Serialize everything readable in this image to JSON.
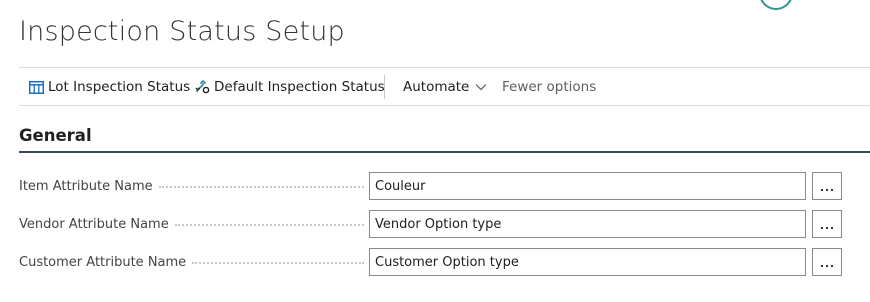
{
  "page": {
    "title": "Inspection Status Setup"
  },
  "actions": {
    "lot_inspection_status": {
      "label": "Lot Inspection Status",
      "icon": "table-icon"
    },
    "default_inspection_status": {
      "label": "Default Inspection Status",
      "icon": "flow-icon"
    },
    "automate": {
      "label": "Automate",
      "icon": "chevron-down-icon"
    },
    "fewer_options": {
      "label": "Fewer options"
    }
  },
  "section": {
    "title": "General"
  },
  "fields": [
    {
      "label": "Item Attribute Name",
      "value": "Couleur"
    },
    {
      "label": "Vendor Attribute Name",
      "value": "Vendor Option type"
    },
    {
      "label": "Customer Attribute Name",
      "value": "Customer Option type"
    }
  ],
  "colors": {
    "accent": "#2f8f97",
    "icon_blue": "#1f6fbf",
    "section_rule": "#3a4a5c"
  }
}
